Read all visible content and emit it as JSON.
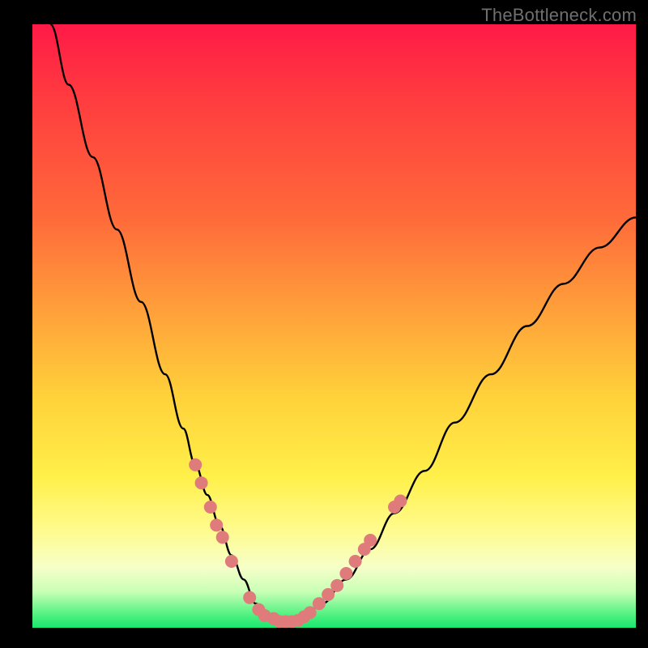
{
  "watermark": "TheBottleneck.com",
  "colors": {
    "background": "#000000",
    "curve": "#000000",
    "marker": "#e07b7b",
    "gradient_stops": [
      "#ff1a47",
      "#ff3b3f",
      "#ff6a3a",
      "#ffa23a",
      "#ffd23a",
      "#fff04a",
      "#fffb8f",
      "#f6ffc8",
      "#c9ffb6",
      "#4cf07f",
      "#19e86f"
    ]
  },
  "chart_data": {
    "type": "line",
    "title": "",
    "xlabel": "",
    "ylabel": "",
    "xlim": [
      0,
      100
    ],
    "ylim": [
      0,
      100
    ],
    "curve": {
      "name": "bottleneck-curve",
      "x": [
        3,
        6,
        10,
        14,
        18,
        22,
        25,
        27,
        29,
        31,
        33,
        35,
        37,
        39,
        41,
        43,
        45,
        48,
        52,
        56,
        60,
        65,
        70,
        76,
        82,
        88,
        94,
        100
      ],
      "y": [
        100,
        90,
        78,
        66,
        54,
        42,
        33,
        27,
        22,
        17,
        12,
        8,
        4,
        2,
        1,
        1,
        2,
        4,
        8,
        13,
        19,
        26,
        34,
        42,
        50,
        57,
        63,
        68
      ]
    },
    "markers": {
      "name": "highlighted-points",
      "points": [
        {
          "x": 27,
          "y": 27
        },
        {
          "x": 28,
          "y": 24
        },
        {
          "x": 29.5,
          "y": 20
        },
        {
          "x": 30.5,
          "y": 17
        },
        {
          "x": 31.5,
          "y": 15
        },
        {
          "x": 33,
          "y": 11
        },
        {
          "x": 36,
          "y": 5
        },
        {
          "x": 37.5,
          "y": 3
        },
        {
          "x": 38.5,
          "y": 2
        },
        {
          "x": 40,
          "y": 1.5
        },
        {
          "x": 41,
          "y": 1
        },
        {
          "x": 42,
          "y": 1
        },
        {
          "x": 43,
          "y": 1
        },
        {
          "x": 44,
          "y": 1.2
        },
        {
          "x": 45,
          "y": 1.8
        },
        {
          "x": 46,
          "y": 2.5
        },
        {
          "x": 47.5,
          "y": 4
        },
        {
          "x": 49,
          "y": 5.5
        },
        {
          "x": 50.5,
          "y": 7
        },
        {
          "x": 52,
          "y": 9
        },
        {
          "x": 53.5,
          "y": 11
        },
        {
          "x": 55,
          "y": 13
        },
        {
          "x": 56,
          "y": 14.5
        },
        {
          "x": 60,
          "y": 20
        },
        {
          "x": 61,
          "y": 21
        }
      ]
    }
  }
}
